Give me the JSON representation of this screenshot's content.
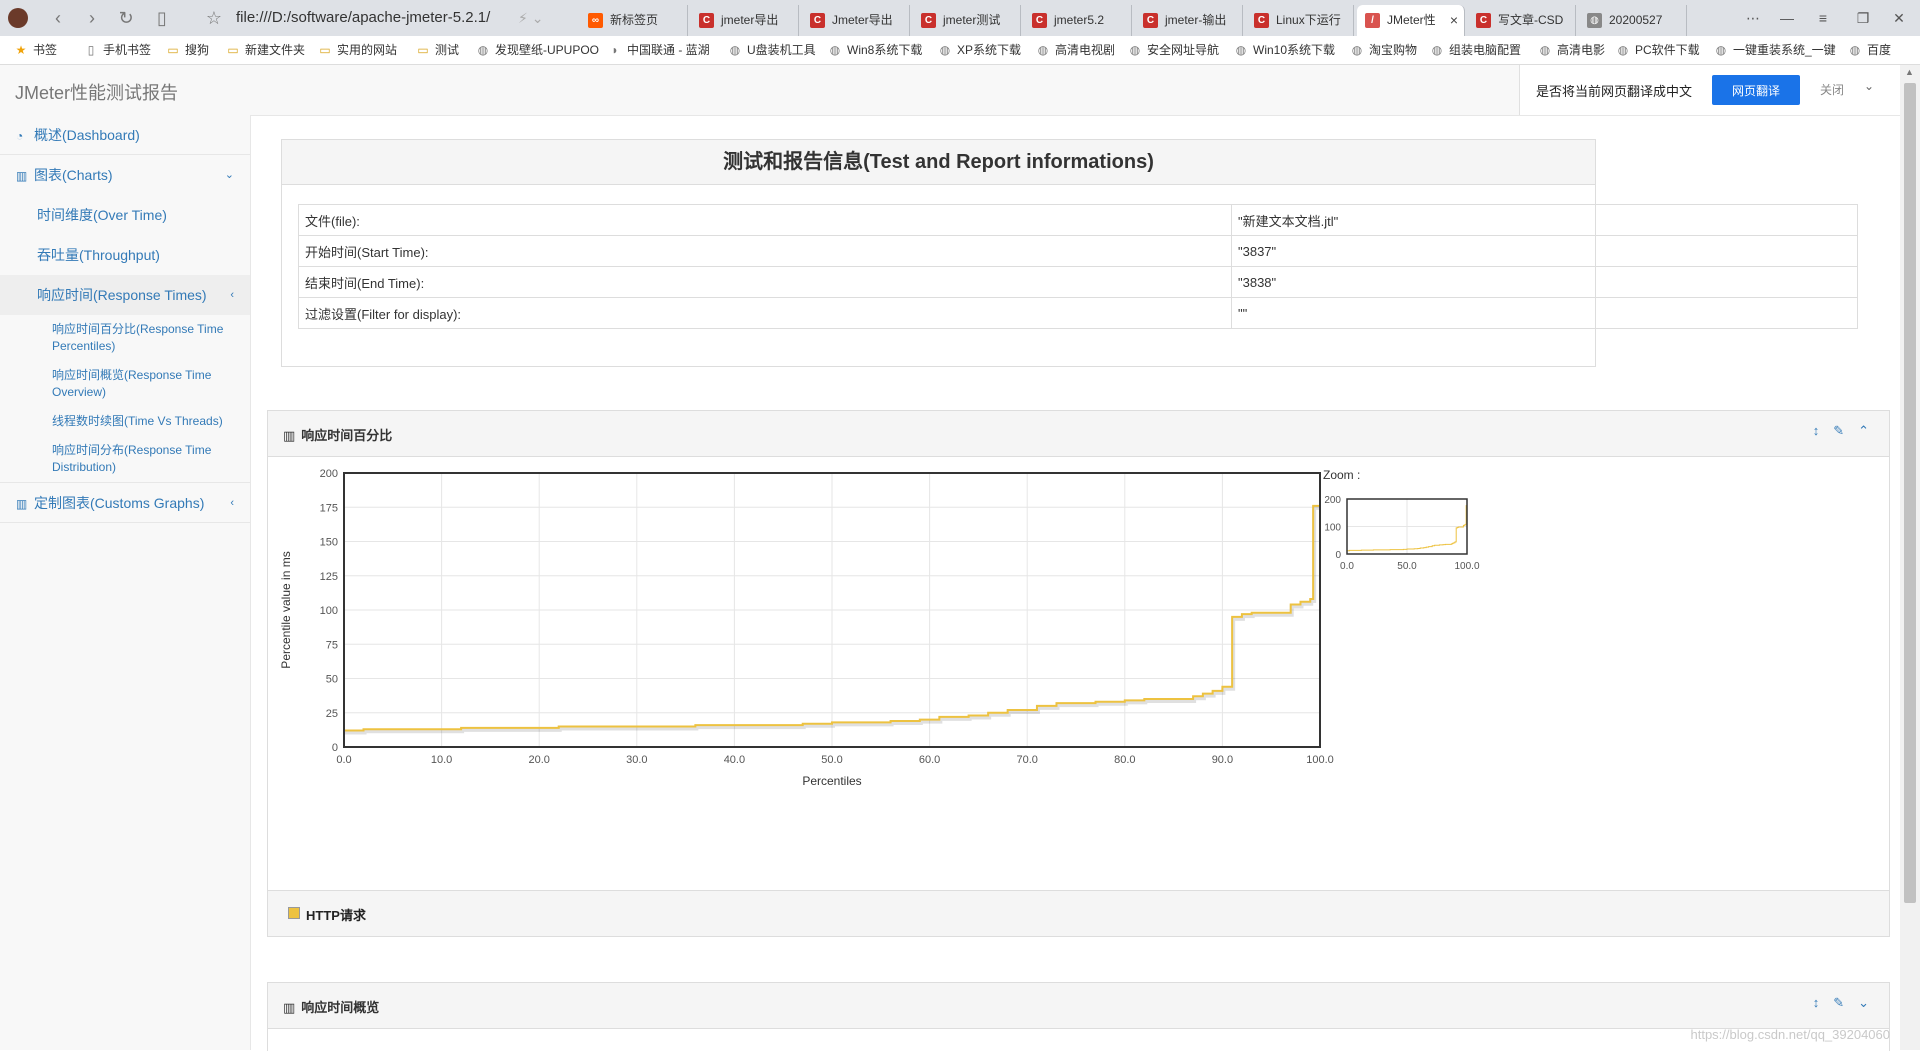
{
  "browser": {
    "address": "file:///D:/software/apache-jmeter-5.2.1/",
    "tabs": [
      {
        "label": "新标签页",
        "icon": "orange-infinity-icon",
        "color": "#ff5a00"
      },
      {
        "label": "jmeter导出",
        "icon": "csdn-icon",
        "color": "#c9302c"
      },
      {
        "label": "Jmeter导出",
        "icon": "csdn-icon",
        "color": "#c9302c"
      },
      {
        "label": "jmeter测试",
        "icon": "csdn-icon",
        "color": "#c9302c"
      },
      {
        "label": "jmeter5.2",
        "icon": "csdn-icon",
        "color": "#c9302c"
      },
      {
        "label": "jmeter-输出",
        "icon": "csdn-icon",
        "color": "#c9302c"
      },
      {
        "label": "Linux下运行",
        "icon": "csdn-icon",
        "color": "#c9302c"
      },
      {
        "label": "JMeter性",
        "icon": "jmeter-feather-icon",
        "color": "#d9534f",
        "active": true
      },
      {
        "label": "写文章-CSD",
        "icon": "csdn-icon",
        "color": "#c9302c"
      },
      {
        "label": "20200527",
        "icon": "globe-icon",
        "color": "#888888"
      }
    ],
    "bookmarks": [
      {
        "label": "书签",
        "icon": "star-icon"
      },
      {
        "label": "手机书签",
        "icon": "phone-icon"
      },
      {
        "label": "搜狗",
        "icon": "folder-icon"
      },
      {
        "label": "新建文件夹",
        "icon": "folder-icon"
      },
      {
        "label": "实用的网站",
        "icon": "folder-icon"
      },
      {
        "label": "测试",
        "icon": "folder-icon"
      },
      {
        "label": "发现壁纸-UPUPOO",
        "icon": "globe-icon"
      },
      {
        "label": "中国联通 - 蓝湖",
        "icon": "lanhu-icon"
      },
      {
        "label": "U盘装机工具",
        "icon": "globe-icon"
      },
      {
        "label": "Win8系统下载",
        "icon": "globe-icon"
      },
      {
        "label": "XP系统下载",
        "icon": "globe-icon"
      },
      {
        "label": "高清电视剧",
        "icon": "globe-icon"
      },
      {
        "label": "安全网址导航",
        "icon": "globe-icon"
      },
      {
        "label": "Win10系统下载",
        "icon": "globe-icon"
      },
      {
        "label": "淘宝购物",
        "icon": "globe-icon"
      },
      {
        "label": "组装电脑配置",
        "icon": "globe-icon"
      },
      {
        "label": "高清电影",
        "icon": "globe-icon"
      },
      {
        "label": "PC软件下载",
        "icon": "globe-icon"
      },
      {
        "label": "一键重装系统_一键",
        "icon": "globe-icon"
      },
      {
        "label": "百度",
        "icon": "globe-icon"
      }
    ]
  },
  "translate_bar": {
    "question": "是否将当前网页翻译成中文",
    "translate_label": "网页翻译",
    "close_label": "关闭"
  },
  "header": {
    "brand": "JMeter性能测试报告"
  },
  "sidebar": {
    "dashboard": "概述(Dashboard)",
    "charts": "图表(Charts)",
    "over_time": "时间维度(Over Time)",
    "throughput": "吞吐量(Throughput)",
    "response_times": "响应时间(Response Times)",
    "rt_percentiles": "响应时间百分比(Response Time Percentiles)",
    "rt_overview": "响应时间概览(Response Time Overview)",
    "time_vs_threads": "线程数时续图(Time Vs Threads)",
    "rt_distribution": "响应时间分布(Response Time Distribution)",
    "custom_graphs": "定制图表(Customs Graphs)"
  },
  "info": {
    "title": "测试和报告信息(Test and Report informations)",
    "rows": [
      {
        "key": "文件(file):",
        "value": "\"新建文本文档.jtl\""
      },
      {
        "key": "开始时间(Start Time):",
        "value": "\"3837\""
      },
      {
        "key": "结束时间(End Time):",
        "value": "\"3838\""
      },
      {
        "key": "过滤设置(Filter for display):",
        "value": "\"\""
      }
    ]
  },
  "percentiles_panel": {
    "title": "响应时间百分比",
    "legend": "HTTP请求"
  },
  "overview_panel": {
    "title": "响应时间概览"
  },
  "watermark": "https://blog.csdn.net/qq_39204060",
  "chart_data": {
    "type": "line",
    "xlabel": "Percentiles",
    "ylabel": "Percentile value in ms",
    "xlim": [
      0,
      100
    ],
    "ylim": [
      0,
      200
    ],
    "xticks": [
      "0.0",
      "10.0",
      "20.0",
      "30.0",
      "40.0",
      "50.0",
      "60.0",
      "70.0",
      "80.0",
      "90.0",
      "100.0"
    ],
    "yticks": [
      "0",
      "25",
      "50",
      "75",
      "100",
      "125",
      "150",
      "175",
      "200"
    ],
    "grid": true,
    "color": "#edc240",
    "series": [
      {
        "name": "HTTP请求",
        "step": true,
        "points": [
          [
            0,
            12
          ],
          [
            2,
            13
          ],
          [
            12,
            14
          ],
          [
            22,
            15
          ],
          [
            36,
            16
          ],
          [
            47,
            17
          ],
          [
            50,
            18
          ],
          [
            56,
            19
          ],
          [
            59,
            20
          ],
          [
            61,
            22
          ],
          [
            64,
            23
          ],
          [
            66,
            25
          ],
          [
            68,
            27
          ],
          [
            71,
            30
          ],
          [
            73,
            32
          ],
          [
            77,
            33
          ],
          [
            80,
            34
          ],
          [
            82,
            35
          ],
          [
            87,
            37
          ],
          [
            88,
            39
          ],
          [
            89,
            41
          ],
          [
            90,
            44
          ],
          [
            91,
            95
          ],
          [
            92,
            97
          ],
          [
            93,
            98
          ],
          [
            97,
            104
          ],
          [
            98,
            106
          ],
          [
            99,
            108
          ],
          [
            99.3,
            176
          ],
          [
            100,
            176
          ]
        ]
      }
    ],
    "zoom": {
      "label": "Zoom :",
      "xticks": [
        "0.0",
        "50.0",
        "100.0"
      ],
      "yticks": [
        "0",
        "100",
        "200"
      ]
    }
  }
}
